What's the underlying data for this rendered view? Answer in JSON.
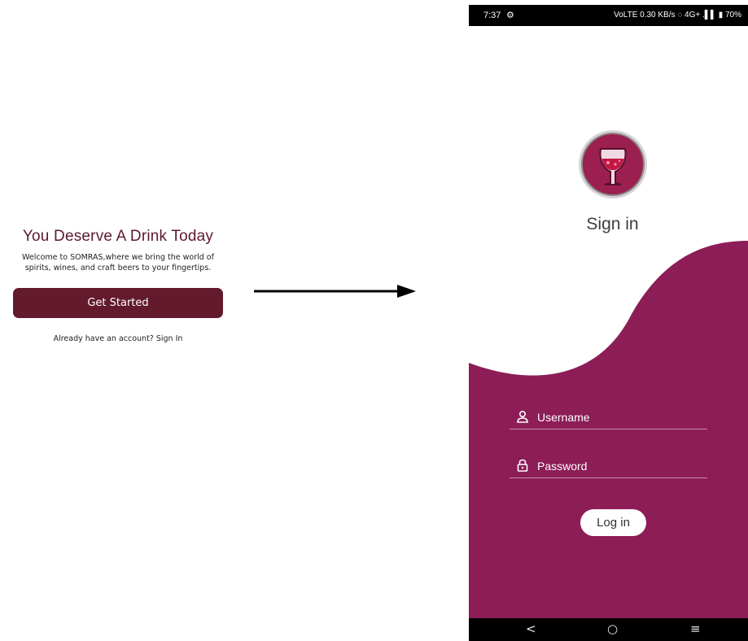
{
  "welcome": {
    "title": "You Deserve A Drink Today",
    "description": "Welcome to SOMRAS,where we bring the world of spirits, wines, and craft beers to your fingertips.",
    "get_started_label": "Get Started",
    "signin_hint": "Already have an account? Sign In"
  },
  "status_bar": {
    "time": "7:37",
    "app_icon": "⚙",
    "indicators": "VoLTE 0.30 KB/s  ◌ 4G+ .▌▌ ▮ 70%"
  },
  "signin": {
    "title": "Sign in",
    "username_label": "Username",
    "password_label": "Password",
    "login_label": "Log in"
  },
  "nav_bar": {
    "back": "<",
    "home": "○",
    "menu": "≡"
  },
  "colors": {
    "brand_dark": "#631a2d",
    "brand_magenta": "#8c1d56",
    "title_text": "#5c1930"
  },
  "icons": [
    "arrow-icon",
    "wine-glass-logo-icon",
    "user-icon",
    "lock-icon",
    "back-icon",
    "home-icon",
    "menu-icon"
  ]
}
